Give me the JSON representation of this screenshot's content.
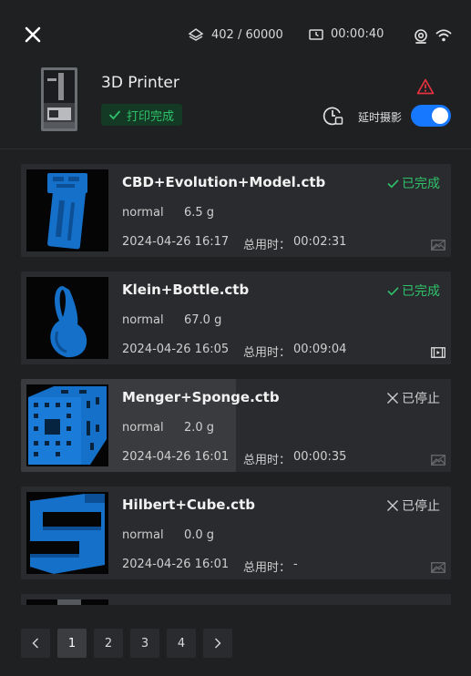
{
  "topbar": {
    "layer_count": "402 / 60000",
    "elapsed_time": "00:00:40",
    "icons": [
      "close-icon",
      "layers-icon",
      "clock-icon",
      "camera-icon",
      "wifi-icon"
    ]
  },
  "printer": {
    "name": "3D Printer",
    "status": "打印完成",
    "status_color": "#2fc26b",
    "warning_color": "#e5323e",
    "timelapse_label": "延时摄影",
    "timelapse_enabled": true,
    "toggle_color": "#1677ff"
  },
  "jobs": [
    {
      "name": "CBD+Evolution+Model.ctb",
      "state": "已完成",
      "state_type": "done",
      "mode": "normal",
      "weight": "6.5 g",
      "date": "2024-04-26 16:17",
      "duration_label": "总用时：",
      "duration": "00:02:31",
      "media": "image-placeholder-icon"
    },
    {
      "name": "Klein+Bottle.ctb",
      "state": "已完成",
      "state_type": "done",
      "mode": "normal",
      "weight": "67.0 g",
      "date": "2024-04-26 16:05",
      "duration_label": "总用时：",
      "duration": "00:09:04",
      "media": "video-icon"
    },
    {
      "name": "Menger+Sponge.ctb",
      "state": "已停止",
      "state_type": "stopped",
      "mode": "normal",
      "weight": "2.0 g",
      "date": "2024-04-26 16:01",
      "duration_label": "总用时：",
      "duration": "00:00:35",
      "media": "image-placeholder-icon"
    },
    {
      "name": "Hilbert+Cube.ctb",
      "state": "已停止",
      "state_type": "stopped",
      "mode": "normal",
      "weight": "0.0 g",
      "date": "2024-04-26 16:01",
      "duration_label": "总用时：",
      "duration": "-",
      "media": "image-placeholder-icon"
    }
  ],
  "pagination": {
    "prev": "‹",
    "next": "›",
    "pages": [
      "1",
      "2",
      "3",
      "4"
    ],
    "current": "1"
  },
  "colors": {
    "background": "#1f2022",
    "card": "#2a2b2e",
    "model_blue": "#1570c9"
  }
}
